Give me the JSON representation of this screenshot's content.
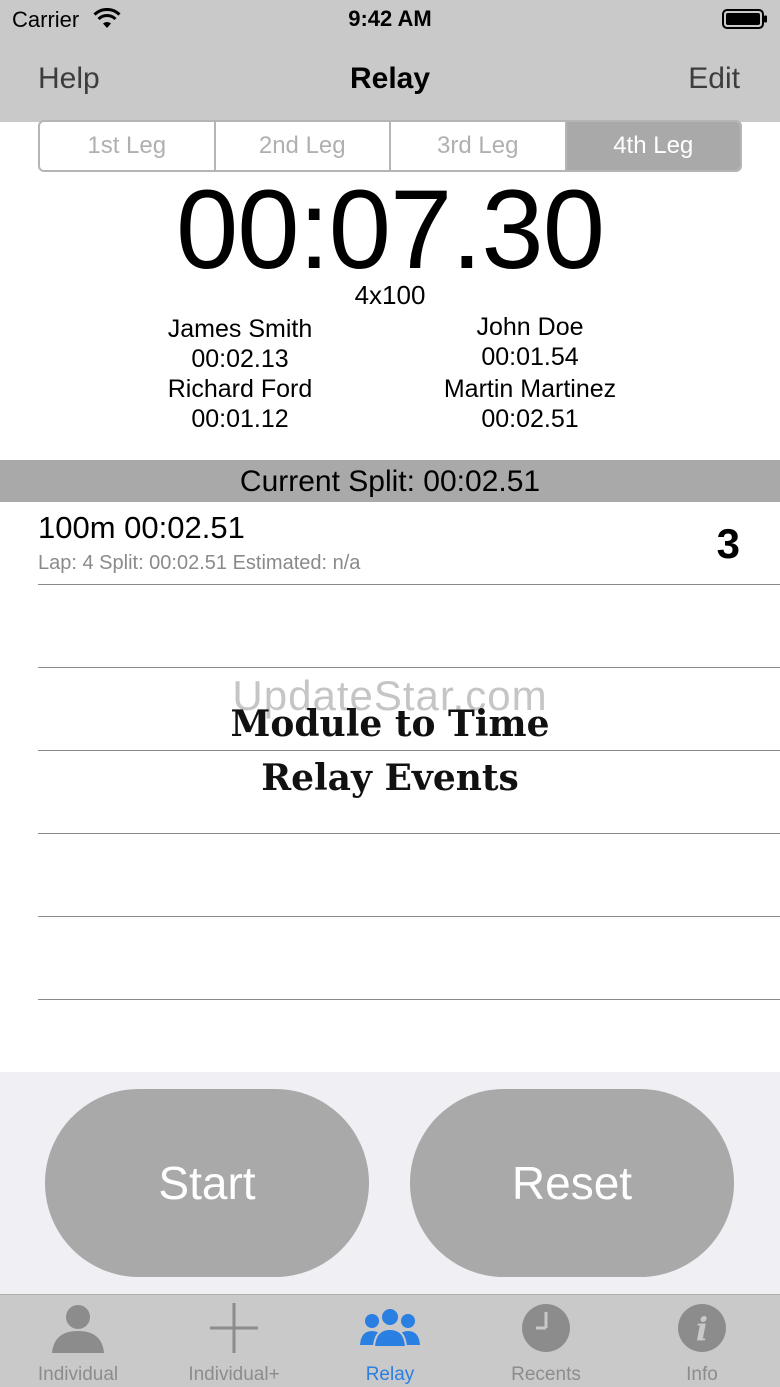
{
  "status_bar": {
    "carrier": "Carrier",
    "time": "9:42 AM"
  },
  "nav": {
    "left": "Help",
    "title": "Relay",
    "right": "Edit"
  },
  "legs": [
    "1st Leg",
    "2nd Leg",
    "3rd Leg",
    "4th Leg"
  ],
  "selected_leg": "4th Leg",
  "timer": "00:07.30",
  "event": "4x100",
  "swimmers": [
    {
      "name": "James Smith",
      "time": "00:02.13"
    },
    {
      "name": "John Doe",
      "time": "00:01.54"
    },
    {
      "name": "Richard Ford",
      "time": "00:01.12"
    },
    {
      "name": "Martin Martinez",
      "time": "00:02.51"
    }
  ],
  "current_split": "Current Split: 00:02.51",
  "laps": [
    {
      "title": "100m 00:02.51",
      "subtitle": "Lap: 4 Split: 00:02.51  Estimated: n/a",
      "badge": "3"
    }
  ],
  "watermark": "UpdateStar.com",
  "caption": {
    "line1": "Module to Time",
    "line2": "Relay Events"
  },
  "buttons": {
    "start": "Start",
    "reset": "Reset"
  },
  "tabs": [
    {
      "label": "Individual",
      "icon": "person-icon"
    },
    {
      "label": "Individual+",
      "icon": "plus-icon"
    },
    {
      "label": "Relay",
      "icon": "group-icon"
    },
    {
      "label": "Recents",
      "icon": "clock-icon"
    },
    {
      "label": "Info",
      "icon": "info-icon"
    }
  ],
  "colors": {
    "bars": "#c9c9c9",
    "accent": "#2a7fe2",
    "button": "#a9a9a9"
  }
}
